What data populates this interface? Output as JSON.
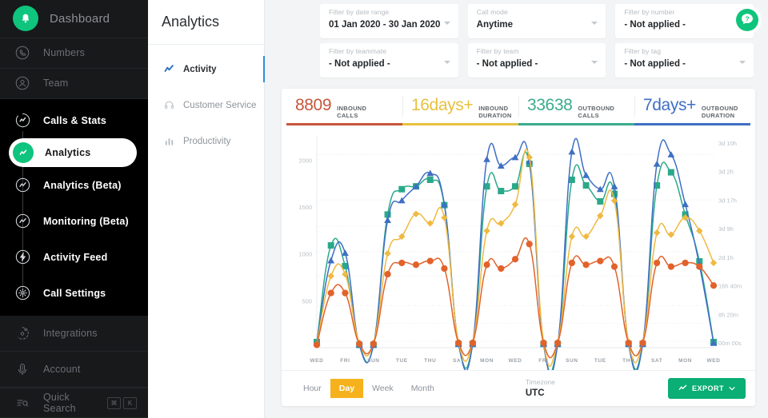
{
  "sidebar": {
    "brand": {
      "label": "Dashboard",
      "icon": "bell-icon"
    },
    "top_items": [
      {
        "label": "Numbers",
        "icon": "phone-icon"
      },
      {
        "label": "Team",
        "icon": "user-icon"
      }
    ],
    "group_items": [
      {
        "label": "Calls & Stats",
        "icon": "stats-ring-icon",
        "active": false
      },
      {
        "label": "Analytics",
        "icon": "analytics-icon",
        "active": true
      },
      {
        "label": "Analytics (Beta)",
        "icon": "analytics-beta-icon",
        "active": false
      },
      {
        "label": "Monitoring (Beta)",
        "icon": "monitoring-icon",
        "active": false
      },
      {
        "label": "Activity Feed",
        "icon": "bolt-icon",
        "active": false
      },
      {
        "label": "Call Settings",
        "icon": "gear-icon",
        "active": false
      }
    ],
    "bottom_items": [
      {
        "label": "Integrations",
        "icon": "integrations-icon"
      },
      {
        "label": "Account",
        "icon": "account-icon"
      }
    ],
    "quick_search": {
      "label": "Quick Search",
      "icon": "quick-search-icon",
      "keys": [
        "⌘",
        "K"
      ]
    }
  },
  "subnav": {
    "title": "Analytics",
    "items": [
      {
        "label": "Activity",
        "icon": "activity-icon",
        "active": true
      },
      {
        "label": "Customer Service",
        "icon": "headset-icon",
        "active": false
      },
      {
        "label": "Productivity",
        "icon": "bar-chart-icon",
        "active": false
      }
    ]
  },
  "filters": [
    {
      "label": "Filter by date range",
      "value": "01 Jan 2020 - 30 Jan 2020",
      "name": "date-range-filter"
    },
    {
      "label": "Call mode",
      "value": "Anytime",
      "name": "call-mode-filter"
    },
    {
      "label": "Filter by number",
      "value": "- Not applied -",
      "name": "number-filter"
    },
    {
      "label": "Filter by teammate",
      "value": "- Not applied -",
      "name": "teammate-filter"
    },
    {
      "label": "Filter by team",
      "value": "- Not applied -",
      "name": "team-filter"
    },
    {
      "label": "Filter by tag",
      "value": "- Not applied -",
      "name": "tag-filter"
    }
  ],
  "kpis": [
    {
      "value": "8809",
      "label_1": "INBOUND",
      "label_2": "CALLS",
      "color": "#c7573b"
    },
    {
      "value": "16days+",
      "label_1": "INBOUND",
      "label_2": "DURATION",
      "color": "#e8c13f"
    },
    {
      "value": "33638",
      "label_1": "OUTBOUND",
      "label_2": "CALLS",
      "color": "#3aab8c"
    },
    {
      "value": "7days+",
      "label_1": "OUTBOUND",
      "label_2": "DURATION",
      "color": "#3f6fc4"
    }
  ],
  "controls": {
    "granularity": [
      {
        "label": "Hour",
        "active": false
      },
      {
        "label": "Day",
        "active": true
      },
      {
        "label": "Week",
        "active": false
      },
      {
        "label": "Month",
        "active": false
      }
    ],
    "timezone_label": "Timezone",
    "timezone_value": "UTC",
    "export_label": "EXPORT",
    "export_icon": "export-chart-icon",
    "caret_icon": "chevron-down-icon"
  },
  "help_button": {
    "icon": "help-chat-icon",
    "glyph": "?",
    "color": "#0fc47c"
  },
  "chart_data": {
    "type": "line",
    "title": "",
    "xlabel": "",
    "ylabel": "",
    "grid": true,
    "legend_position": "none",
    "categories": [
      "WED",
      "THU",
      "FRI",
      "SAT",
      "SUN",
      "MON",
      "TUE",
      "WED",
      "THU",
      "FRI",
      "SAT",
      "SUN",
      "MON",
      "TUE",
      "WED",
      "THU",
      "FRI",
      "SAT",
      "SUN",
      "MON",
      "TUE",
      "WED",
      "THU",
      "FRI",
      "SAT",
      "SUN",
      "MON",
      "TUE",
      "WED"
    ],
    "xtick_labels": [
      "WED",
      "FRI",
      "SUN",
      "TUE",
      "THU",
      "SAT",
      "MON",
      "WED",
      "FRI",
      "SUN",
      "TUE",
      "THU",
      "SAT",
      "MON",
      "WED"
    ],
    "left_axis": {
      "name": "calls",
      "ticks": [
        "2000",
        "1500",
        "1000",
        "500"
      ],
      "tick_values": [
        2000,
        1500,
        1000,
        500
      ],
      "ylim": [
        0,
        2250
      ]
    },
    "right_axis": {
      "name": "duration",
      "ticks": [
        "3d 10h",
        "3d 2h",
        "3d 17h",
        "3d 9h",
        "2d 1h",
        "16h 40m",
        "8h 20m",
        "00m 00s"
      ],
      "tick_values": [
        295200,
        266400,
        234000,
        205200,
        176400,
        60000,
        30000,
        0
      ]
    },
    "series": [
      {
        "name": "Outbound calls",
        "color": "#2aa98a",
        "marker": "square",
        "axis": "left",
        "values": [
          60,
          1090,
          870,
          30,
          30,
          1420,
          1690,
          1720,
          1790,
          1520,
          40,
          40,
          1720,
          1670,
          1720,
          1960,
          40,
          40,
          1790,
          1730,
          1560,
          1640,
          40,
          40,
          1730,
          1870,
          1420,
          920,
          60
        ]
      },
      {
        "name": "Inbound calls",
        "color": "#3f6fc4",
        "marker": "triangle",
        "axis": "left",
        "values": [
          50,
          930,
          1010,
          30,
          30,
          1360,
          1570,
          1720,
          1860,
          1530,
          40,
          40,
          2010,
          1940,
          2030,
          1990,
          40,
          40,
          2090,
          1840,
          1690,
          1720,
          40,
          40,
          1960,
          2060,
          1530,
          880,
          50
        ]
      },
      {
        "name": "Inbound duration",
        "color": "#f0b940",
        "marker": "diamond",
        "axis": "right",
        "values": [
          20,
          380,
          390,
          25,
          25,
          500,
          590,
          710,
          660,
          690,
          30,
          30,
          620,
          660,
          760,
          1010,
          30,
          30,
          590,
          590,
          700,
          780,
          30,
          30,
          610,
          600,
          690,
          620,
          450
        ]
      },
      {
        "name": "Outbound duration",
        "color": "#e2622b",
        "marker": "circle",
        "axis": "right",
        "values": [
          15,
          290,
          290,
          20,
          20,
          390,
          450,
          440,
          460,
          420,
          25,
          25,
          440,
          420,
          470,
          550,
          25,
          25,
          450,
          440,
          460,
          430,
          25,
          25,
          450,
          430,
          450,
          430,
          330
        ]
      }
    ]
  }
}
